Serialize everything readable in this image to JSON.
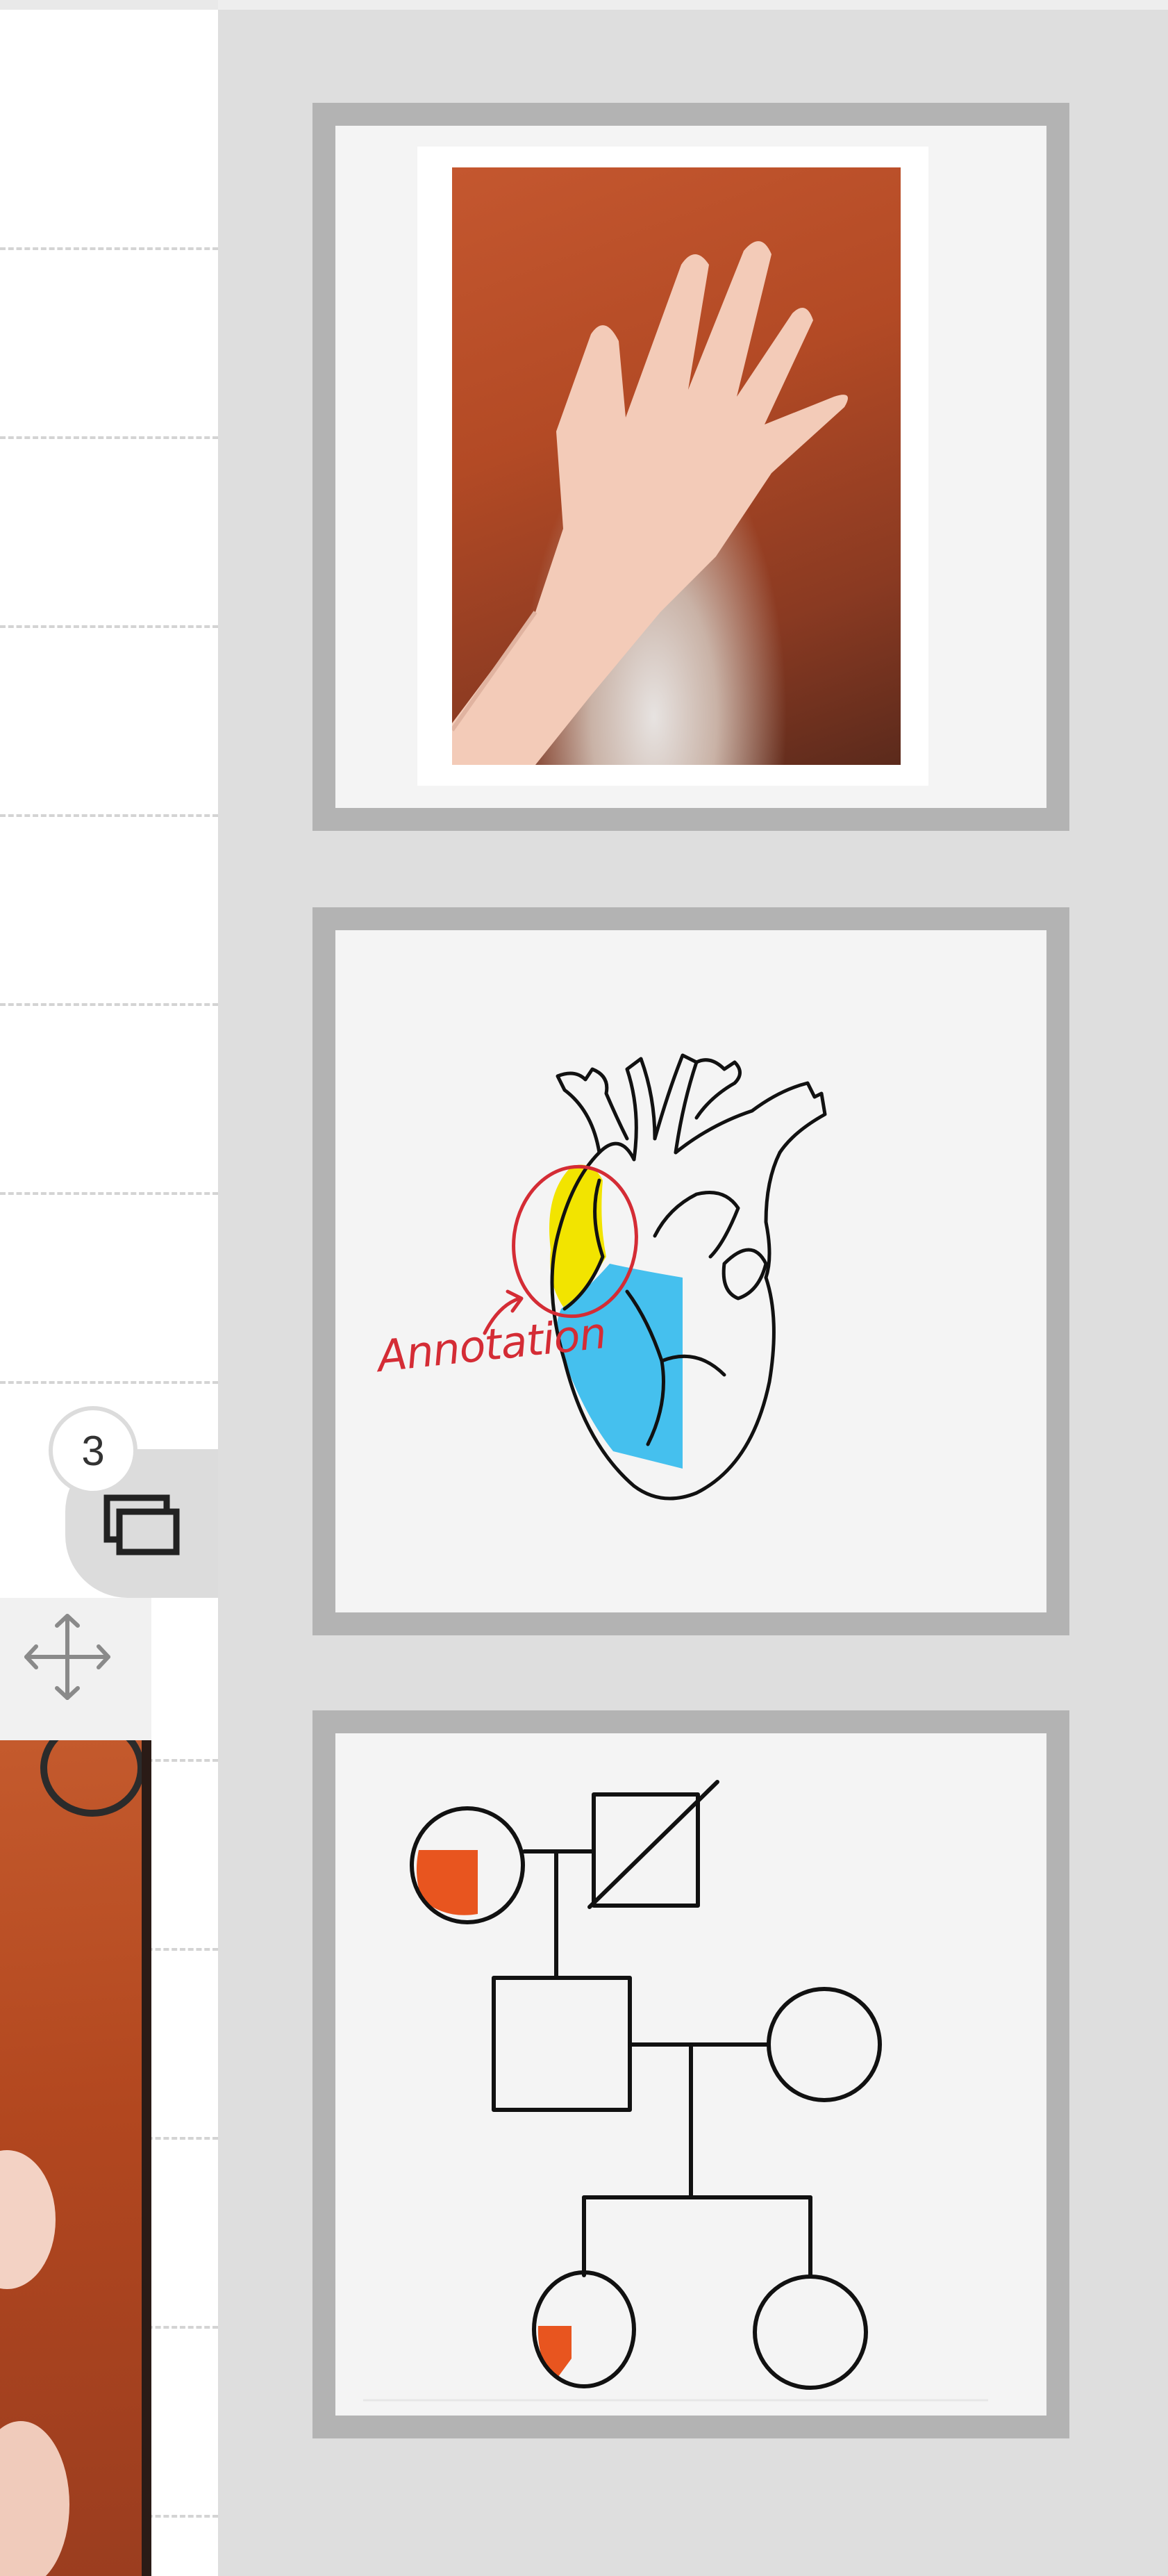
{
  "group": {
    "page_count": "3",
    "icon": "stacked-pages-icon"
  },
  "move_handle": {
    "icon": "move-arrows-icon"
  },
  "thumbnails": [
    {
      "name": "palm-photo",
      "kind": "photo"
    },
    {
      "name": "heart-diagram",
      "kind": "drawing",
      "annotation_label": "Annotation"
    },
    {
      "name": "pedigree-chart",
      "kind": "drawing"
    }
  ],
  "colors": {
    "panel_bg": "#dedede",
    "frame": "#b3b3b3",
    "card": "#f4f4f4",
    "annotation_red": "#d42c35",
    "highlight_yellow": "#f2e400",
    "highlight_blue": "#45c0ee",
    "pedigree_fill": "#e8551f"
  }
}
